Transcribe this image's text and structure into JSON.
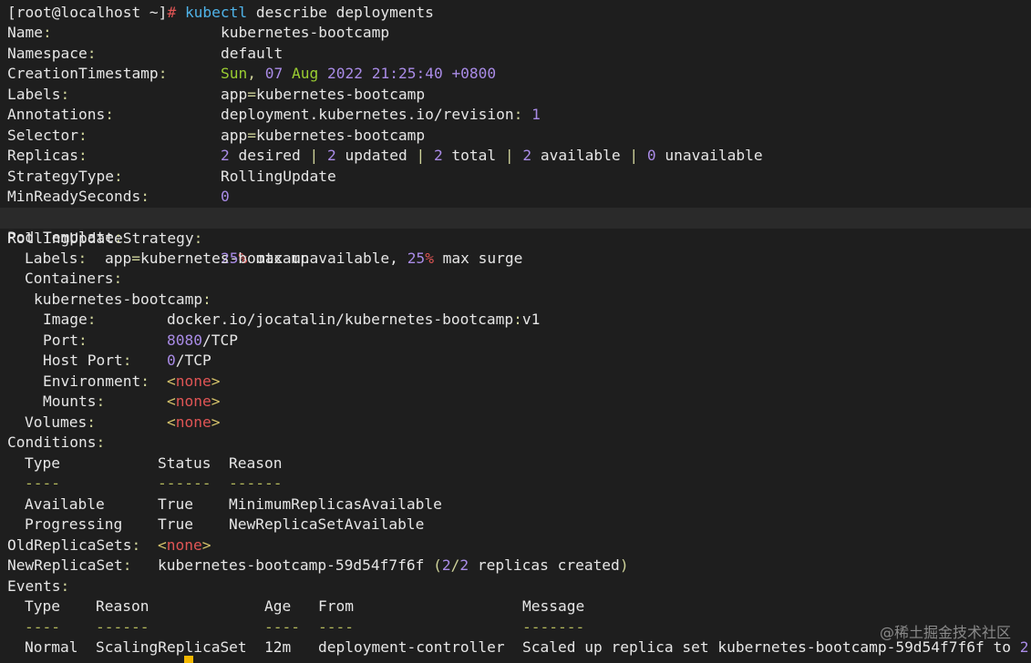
{
  "prompt": {
    "user": "[root@localhost ~]",
    "hash": "#",
    "cmd": "kubectl",
    "args": " describe deployments"
  },
  "fields": {
    "name_label": "Name",
    "name_value": "kubernetes-bootcamp",
    "namespace_label": "Namespace",
    "namespace_value": "default",
    "ts_label": "CreationTimestamp",
    "ts_day": "Sun",
    "ts_daynum": "07",
    "ts_month": " Aug ",
    "ts_year": "2022",
    "ts_time": "21:25:40",
    "ts_tz": "+0800",
    "labels_label": "Labels",
    "labels_key": "app",
    "labels_value": "kubernetes-bootcamp",
    "ann_label": "Annotations",
    "ann_key": "deployment.kubernetes.io/revision",
    "ann_value": "1",
    "selector_label": "Selector",
    "selector_key": "app",
    "selector_value": "kubernetes-bootcamp",
    "replicas_label": "Replicas",
    "rep_desired_n": "2",
    "rep_desired": " desired ",
    "rep_updated_n": "2",
    "rep_updated": " updated ",
    "rep_total_n": "2",
    "rep_total": " total ",
    "rep_avail_n": "2",
    "rep_avail": " available ",
    "rep_unavail_n": "0",
    "rep_unavail": " unavailable",
    "strategy_label": "StrategyType",
    "strategy_value": "RollingUpdate",
    "minready_label": "MinReadySeconds",
    "minready_value": "0",
    "rus_label": "RollingUpdateStrategy",
    "rus_n1": "25",
    "rus_t1": " max unavailable, ",
    "rus_n2": "25",
    "rus_t2": " max surge"
  },
  "pod_template": {
    "label": "Pod Template",
    "labels_label": "Labels",
    "labels_key": "app",
    "labels_value": "kubernetes-bootcamp",
    "containers_label": "Containers",
    "container_name": "kubernetes-bootcamp",
    "image_label": "Image",
    "image_value": "docker.io/jocatalin/kubernetes-bootcamp",
    "image_tag": "v1",
    "port_label": "Port",
    "port_n": "8080",
    "port_proto": "/TCP",
    "hostport_label": "Host Port",
    "hostport_n": "0",
    "hostport_proto": "/TCP",
    "env_label": "Environment",
    "mounts_label": "Mounts",
    "volumes_label": "Volumes",
    "none": "none"
  },
  "conditions": {
    "label": "Conditions",
    "headers": [
      "Type",
      "Status",
      "Reason"
    ],
    "dashes": [
      "----",
      "------",
      "------"
    ],
    "rows": [
      [
        "Available",
        "True",
        "MinimumReplicasAvailable"
      ],
      [
        "Progressing",
        "True",
        "NewReplicaSetAvailable"
      ]
    ]
  },
  "old_rs": {
    "label": "OldReplicaSets",
    "value": "none"
  },
  "new_rs": {
    "label": "NewReplicaSet",
    "value": "kubernetes-bootcamp-59d54f7f6f",
    "n1": "2",
    "n2": "2",
    "text": " replicas created"
  },
  "events": {
    "label": "Events",
    "headers": [
      "Type",
      "Reason",
      "Age",
      "From",
      "Message"
    ],
    "dashes": [
      "----",
      "------",
      "----",
      "----",
      "-------"
    ],
    "row": [
      "Normal",
      "ScalingReplicaSet",
      "12m",
      "deployment-controller",
      "Scaled up replica set kubernetes-bootcamp-59d54f7f6f to ",
      "2"
    ]
  },
  "watermark": "@稀土掘金技术社区",
  "colors": {
    "background": "#1e1e1e",
    "number": "#a98be6",
    "none": "#e05555",
    "command": "#4fb3e8",
    "cursor": "#f2b700"
  }
}
